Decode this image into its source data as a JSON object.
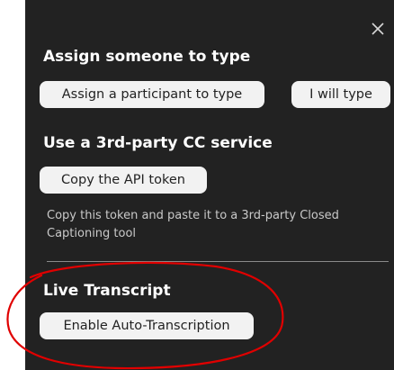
{
  "panel": {
    "close_icon": "close-icon",
    "sections": {
      "assign": {
        "heading": "Assign someone to type",
        "assign_button": "Assign a participant to type",
        "self_button": "I will type"
      },
      "third_party": {
        "heading": "Use a 3rd-party CC service",
        "copy_button": "Copy the API token",
        "note": "Copy this token and paste it to a 3rd-party Closed Captioning tool"
      },
      "live": {
        "heading": "Live Transcript",
        "enable_button": "Enable Auto-Transcription"
      }
    }
  },
  "colors": {
    "panel_bg": "#222222",
    "button_bg": "#f2f2f2",
    "annotation": "#e00000"
  }
}
